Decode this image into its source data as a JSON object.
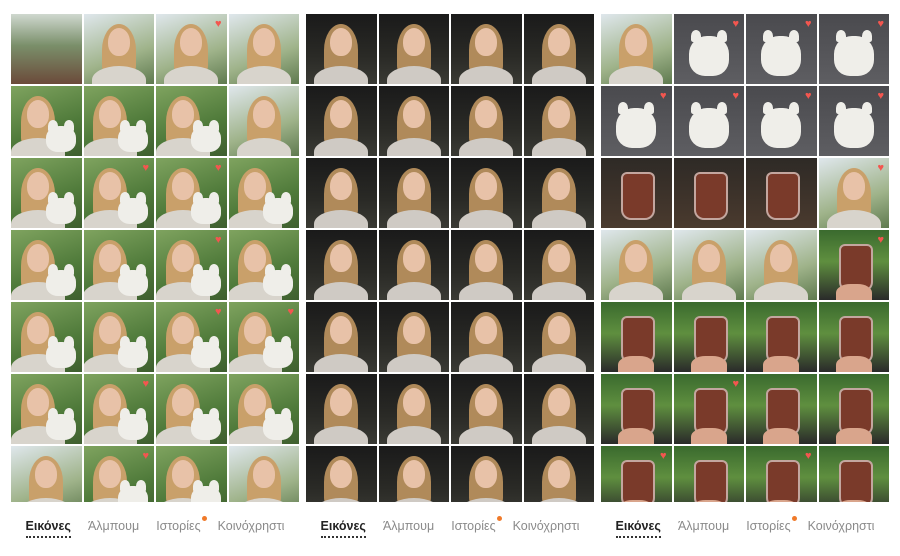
{
  "colors": {
    "heart": "#f3564f",
    "badge_dot": "#f07a2a",
    "active_tab": "#222222",
    "inactive_tab": "#8a8a8a"
  },
  "panels": [
    {
      "name": "panel-left",
      "tabs": [
        {
          "label": "Εικόνες",
          "active": true,
          "badge": false
        },
        {
          "label": "Άλμπουμ",
          "active": false,
          "badge": false
        },
        {
          "label": "Ιστορίες",
          "active": false,
          "badge": true
        },
        {
          "label": "Κοινόχρηστι",
          "active": false,
          "badge": false
        }
      ],
      "photos": [
        {
          "scene": "table",
          "heart": false
        },
        {
          "scene": "selfie",
          "heart": false
        },
        {
          "scene": "selfie",
          "heart": true
        },
        {
          "scene": "selfie",
          "heart": false
        },
        {
          "scene": "selfie-dog",
          "heart": false
        },
        {
          "scene": "selfie-dog",
          "heart": false
        },
        {
          "scene": "selfie-dog",
          "heart": false
        },
        {
          "scene": "selfie",
          "heart": false
        },
        {
          "scene": "selfie-dog",
          "heart": false
        },
        {
          "scene": "selfie-dog",
          "heart": true
        },
        {
          "scene": "selfie-dog",
          "heart": true
        },
        {
          "scene": "selfie-dog",
          "heart": false
        },
        {
          "scene": "selfie-dog",
          "heart": false
        },
        {
          "scene": "selfie-dog",
          "heart": false
        },
        {
          "scene": "selfie-dog",
          "heart": true
        },
        {
          "scene": "selfie-dog",
          "heart": false
        },
        {
          "scene": "selfie-dog",
          "heart": false
        },
        {
          "scene": "selfie-dog",
          "heart": false
        },
        {
          "scene": "selfie-dog",
          "heart": true
        },
        {
          "scene": "selfie-dog",
          "heart": true
        },
        {
          "scene": "selfie-dog",
          "heart": false
        },
        {
          "scene": "selfie-dog",
          "heart": true
        },
        {
          "scene": "selfie-dog",
          "heart": false
        },
        {
          "scene": "selfie-dog",
          "heart": false
        },
        {
          "scene": "selfie",
          "heart": false
        },
        {
          "scene": "selfie-dog",
          "heart": true
        },
        {
          "scene": "selfie-dog",
          "heart": false
        },
        {
          "scene": "selfie",
          "heart": false
        }
      ]
    },
    {
      "name": "panel-middle",
      "tabs": [
        {
          "label": "Εικόνες",
          "active": true,
          "badge": false
        },
        {
          "label": "Άλμπουμ",
          "active": false,
          "badge": false
        },
        {
          "label": "Ιστορίες",
          "active": false,
          "badge": true
        },
        {
          "label": "Κοινόχρηστι",
          "active": false,
          "badge": false
        }
      ],
      "photos": [
        {
          "scene": "night",
          "heart": false
        },
        {
          "scene": "night",
          "heart": false
        },
        {
          "scene": "night",
          "heart": false
        },
        {
          "scene": "night",
          "heart": false
        },
        {
          "scene": "night",
          "heart": false
        },
        {
          "scene": "night",
          "heart": false
        },
        {
          "scene": "night",
          "heart": false
        },
        {
          "scene": "night",
          "heart": false
        },
        {
          "scene": "night",
          "heart": false
        },
        {
          "scene": "night",
          "heart": false
        },
        {
          "scene": "night",
          "heart": false
        },
        {
          "scene": "night",
          "heart": false
        },
        {
          "scene": "night",
          "heart": false
        },
        {
          "scene": "night",
          "heart": false
        },
        {
          "scene": "night",
          "heart": false
        },
        {
          "scene": "night",
          "heart": false
        },
        {
          "scene": "night",
          "heart": false
        },
        {
          "scene": "night",
          "heart": false
        },
        {
          "scene": "night",
          "heart": false
        },
        {
          "scene": "night",
          "heart": false
        },
        {
          "scene": "night",
          "heart": false
        },
        {
          "scene": "night",
          "heart": false
        },
        {
          "scene": "night",
          "heart": false
        },
        {
          "scene": "night",
          "heart": false
        },
        {
          "scene": "night",
          "heart": false
        },
        {
          "scene": "night",
          "heart": false
        },
        {
          "scene": "night",
          "heart": false
        },
        {
          "scene": "night",
          "heart": false
        }
      ]
    },
    {
      "name": "panel-right",
      "tabs": [
        {
          "label": "Εικόνες",
          "active": true,
          "badge": false
        },
        {
          "label": "Άλμπουμ",
          "active": false,
          "badge": false
        },
        {
          "label": "Ιστορίες",
          "active": false,
          "badge": true
        },
        {
          "label": "Κοινόχρηστι",
          "active": false,
          "badge": false
        }
      ],
      "photos": [
        {
          "scene": "selfie",
          "heart": false
        },
        {
          "scene": "dog",
          "heart": true
        },
        {
          "scene": "dog",
          "heart": true
        },
        {
          "scene": "dog",
          "heart": true
        },
        {
          "scene": "dog",
          "heart": true
        },
        {
          "scene": "dog",
          "heart": true
        },
        {
          "scene": "dog",
          "heart": true
        },
        {
          "scene": "dog",
          "heart": true
        },
        {
          "scene": "drink-table",
          "heart": false
        },
        {
          "scene": "drink-table",
          "heart": false
        },
        {
          "scene": "drink-table",
          "heart": false
        },
        {
          "scene": "selfie",
          "heart": true
        },
        {
          "scene": "selfie",
          "heart": false
        },
        {
          "scene": "selfie",
          "heart": false
        },
        {
          "scene": "selfie",
          "heart": false
        },
        {
          "scene": "drink",
          "heart": true
        },
        {
          "scene": "drink",
          "heart": false
        },
        {
          "scene": "drink",
          "heart": false
        },
        {
          "scene": "drink",
          "heart": false
        },
        {
          "scene": "drink",
          "heart": false
        },
        {
          "scene": "drink",
          "heart": false
        },
        {
          "scene": "drink",
          "heart": true
        },
        {
          "scene": "drink",
          "heart": false
        },
        {
          "scene": "drink",
          "heart": false
        },
        {
          "scene": "drink",
          "heart": true
        },
        {
          "scene": "drink",
          "heart": false
        },
        {
          "scene": "drink",
          "heart": true
        },
        {
          "scene": "drink",
          "heart": false
        }
      ]
    }
  ]
}
